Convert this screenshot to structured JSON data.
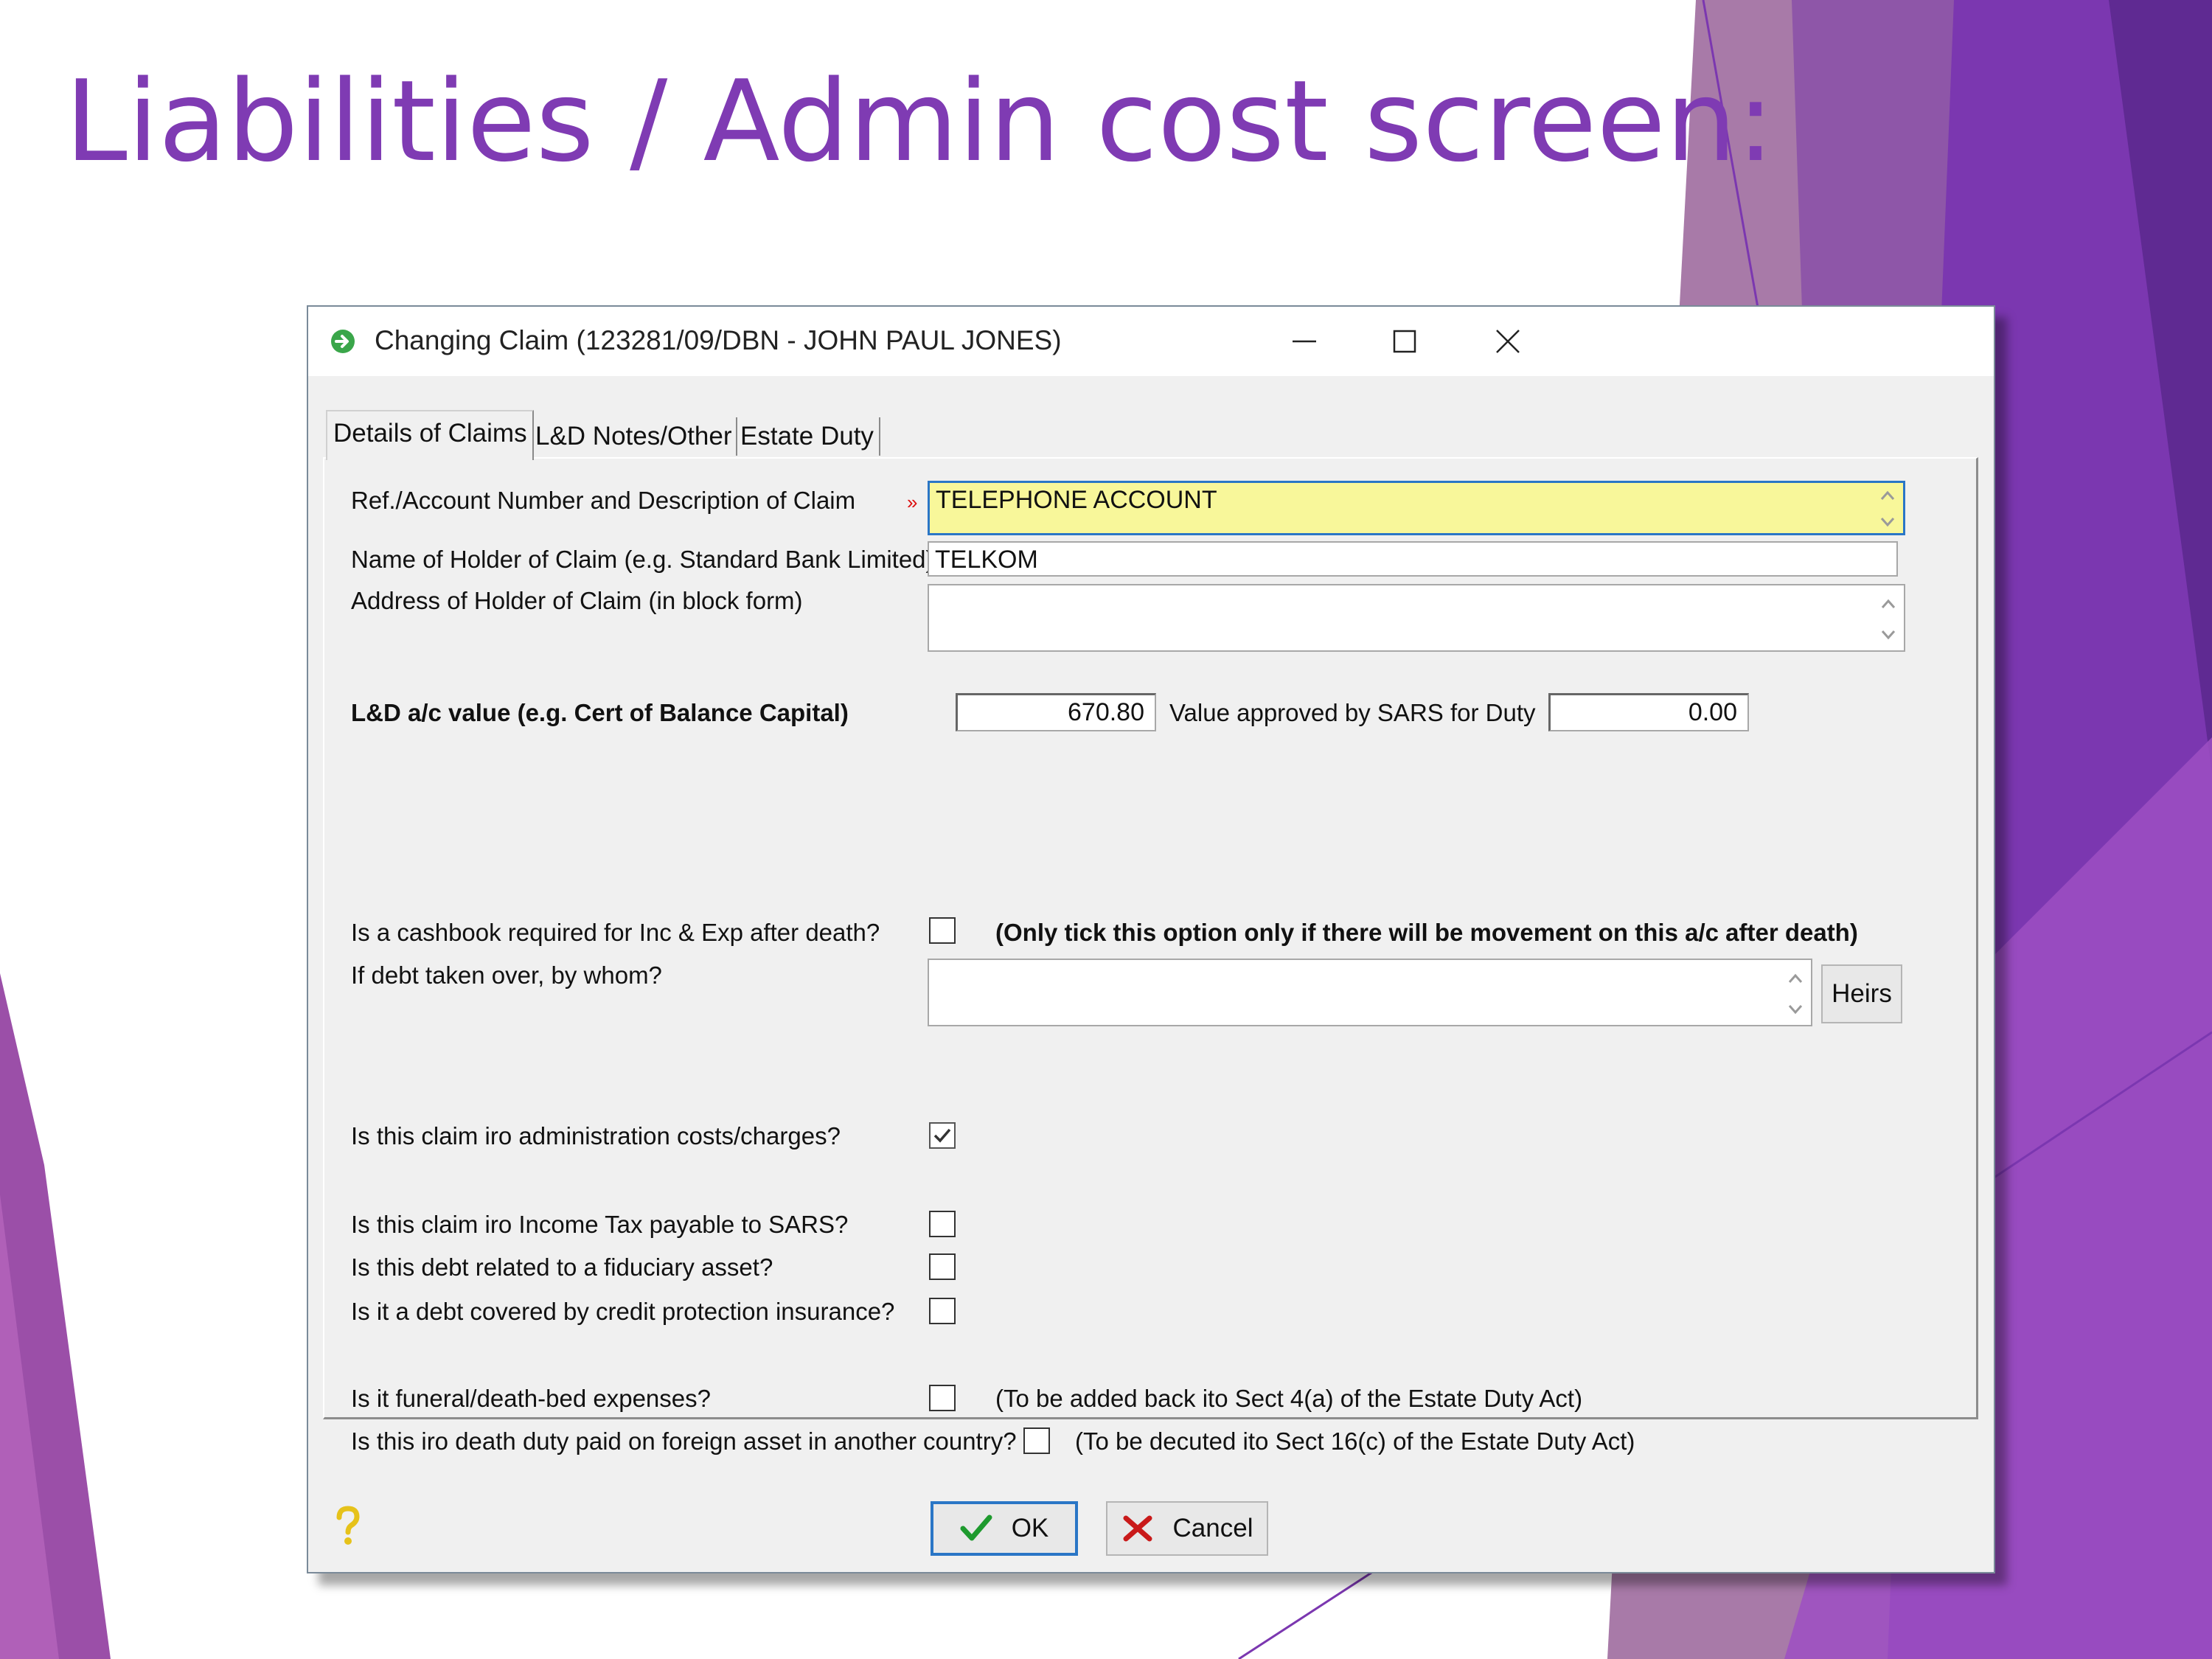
{
  "slide": {
    "title": "Liabilities / Admin cost screen:"
  },
  "colors": {
    "accent_purple": "#7f3bb3",
    "focus_yellow": "#f8f79a",
    "focus_blue": "#2a76c6"
  },
  "window": {
    "title": "Changing Claim  (123281/09/DBN - JOHN PAUL JONES)",
    "icon": "green-arrow-icon",
    "controls": [
      "minimize-icon",
      "maximize-icon",
      "close-icon"
    ]
  },
  "tabs": [
    {
      "label": "Details of Claims",
      "active": true
    },
    {
      "label": "L&D Notes/Other",
      "active": false
    },
    {
      "label": "Estate Duty",
      "active": false
    }
  ],
  "form": {
    "ref_label": "Ref./Account Number and Description of Claim",
    "ref_required_mark": "»",
    "ref_value": "TELEPHONE ACCOUNT",
    "holder_name_label": "Name of Holder of Claim (e.g. Standard Bank Limited)",
    "holder_name_value": "TELKOM",
    "holder_address_label": "Address of Holder of Claim (in block form)",
    "holder_address_value": "",
    "ld_value_label": "L&D a/c value (e.g. Cert of Balance Capital)",
    "ld_value": "670.80",
    "sars_value_label": "Value approved by SARS for Duty",
    "sars_value": "0.00",
    "cashbook_label": "Is a cashbook required for Inc & Exp after death?",
    "cashbook_checked": false,
    "cashbook_note": "(Only tick this option only if there will be movement on this a/c after death)",
    "debt_taken_label": "If debt taken over, by whom?",
    "debt_taken_value": "",
    "heirs_button": "Heirs",
    "admin_costs_label": "Is this claim iro administration costs/charges?",
    "admin_costs_checked": true,
    "income_tax_label": "Is this claim iro Income Tax payable to SARS?",
    "income_tax_checked": false,
    "fiduciary_label": "Is this debt related to a fiduciary asset?",
    "fiduciary_checked": false,
    "credit_protection_label": "Is it a debt covered by credit protection insurance?",
    "credit_protection_checked": false,
    "funeral_label": "Is it funeral/death-bed expenses?",
    "funeral_checked": false,
    "funeral_note": "(To be added back ito Sect 4(a) of the Estate Duty Act)",
    "foreign_duty_label": "Is this iro death duty paid on foreign asset in another country?",
    "foreign_duty_checked": false,
    "foreign_duty_note": "(To be decuted ito Sect 16(c) of the Estate Duty Act)"
  },
  "footer": {
    "help_icon": "question-mark-icon",
    "ok_label": "OK",
    "ok_icon": "green-check-icon",
    "cancel_label": "Cancel",
    "cancel_icon": "red-x-icon"
  }
}
